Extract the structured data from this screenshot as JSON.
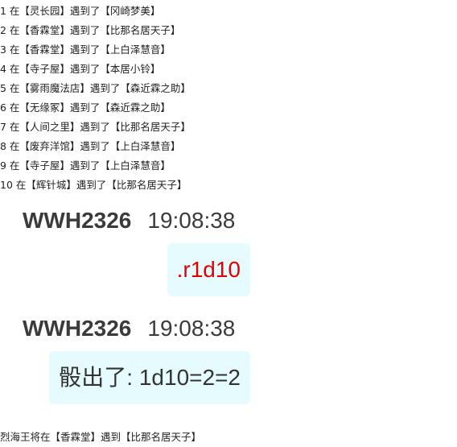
{
  "log": {
    "lines": [
      "1 在【灵长园】遇到了【冈崎梦美】",
      "2 在【香霖堂】遇到了【比那名居天子】",
      "3 在【香霖堂】遇到了【上白泽慧音】",
      "4 在【寺子屋】遇到了【本居小铃】",
      "5 在【雾雨魔法店】遇到了【森近霖之助】",
      "6 在【无缘冢】遇到了【森近霖之助】",
      "7 在【人间之里】遇到了【比那名居天子】",
      "8 在【废弃洋馆】遇到了【上白泽慧音】",
      "9 在【寺子屋】遇到了【上白泽慧音】",
      "10 在【辉针城】遇到了【比那名居天子】"
    ]
  },
  "messages": [
    {
      "username": "WWH2326",
      "time": "19:08:38",
      "text": ".r1d10",
      "color": "#e60000"
    },
    {
      "username": "WWH2326",
      "time": "19:08:38",
      "text": "骰出了: 1d10=2=2",
      "color": "#333333"
    }
  ],
  "footer": {
    "text": "烈海王将在【香霖堂】遇到【比那名居天子】"
  },
  "colors": {
    "bubble_bg": "#e5fbfd",
    "command_text": "#e60000",
    "username_text": "#3b3b3b"
  }
}
